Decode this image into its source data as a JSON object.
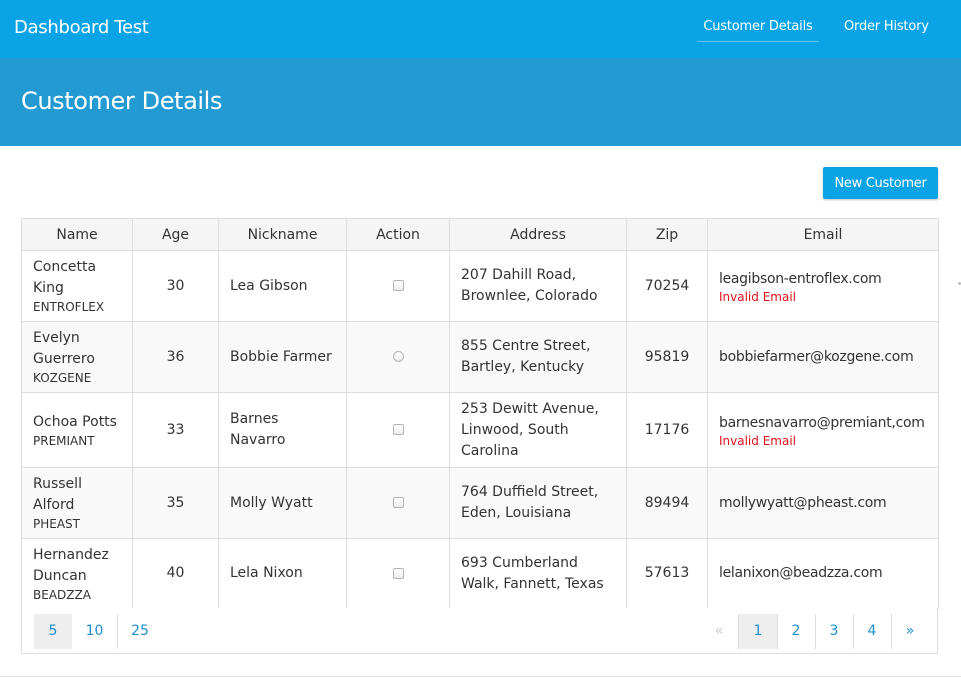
{
  "app": {
    "title": "Dashboard Test"
  },
  "nav": {
    "items": [
      {
        "label": "Customer Details",
        "active": true
      },
      {
        "label": "Order History",
        "active": false
      }
    ]
  },
  "page": {
    "title": "Customer Details"
  },
  "toolbar": {
    "new_customer_label": "New Customer"
  },
  "table": {
    "columns": [
      "Name",
      "Age",
      "Nickname",
      "Action",
      "Address",
      "Zip",
      "Email"
    ],
    "rows": [
      {
        "name": "Concetta King",
        "company": "ENTROFLEX",
        "age": "30",
        "nickname": "Lea Gibson",
        "action": "checkbox",
        "address": "207 Dahill Road, Brownlee, Colorado",
        "zip": "70254",
        "email": "leagibson-entroflex.com",
        "error": "Invalid Email"
      },
      {
        "name": "Evelyn Guerrero",
        "company": "KOZGENE",
        "age": "36",
        "nickname": "Bobbie Farmer",
        "action": "radio",
        "address": "855 Centre Street, Bartley, Kentucky",
        "zip": "95819",
        "email": "bobbiefarmer@kozgene.com",
        "error": ""
      },
      {
        "name": "Ochoa Potts",
        "company": "PREMIANT",
        "age": "33",
        "nickname": "Barnes Navarro",
        "action": "checkbox",
        "address": "253 Dewitt Avenue, Linwood, South Carolina",
        "zip": "17176",
        "email": "barnesnavarro@premiant,com",
        "error": "Invalid Email"
      },
      {
        "name": "Russell Alford",
        "company": "PHEAST",
        "age": "35",
        "nickname": "Molly Wyatt",
        "action": "checkbox",
        "address": "764 Duffield Street, Eden, Louisiana",
        "zip": "89494",
        "email": "mollywyatt@pheast.com",
        "error": ""
      },
      {
        "name": "Hernandez Duncan",
        "company": "BEADZZA",
        "age": "40",
        "nickname": "Lela Nixon",
        "action": "checkbox",
        "address": "693 Cumberland Walk, Fannett, Texas",
        "zip": "57613",
        "email": "lelanixon@beadzza.com",
        "error": ""
      }
    ]
  },
  "pagination": {
    "page_sizes": [
      "5",
      "10",
      "25"
    ],
    "active_page_size": "5",
    "prev": "«",
    "next": "»",
    "pages": [
      "1",
      "2",
      "3",
      "4"
    ],
    "current_page": "1"
  },
  "colors": {
    "navbar": "#0aa3e6",
    "header": "#239ad1",
    "accent": "#0aa3e6",
    "link": "#1e8fd0",
    "error": "#e3101a"
  }
}
